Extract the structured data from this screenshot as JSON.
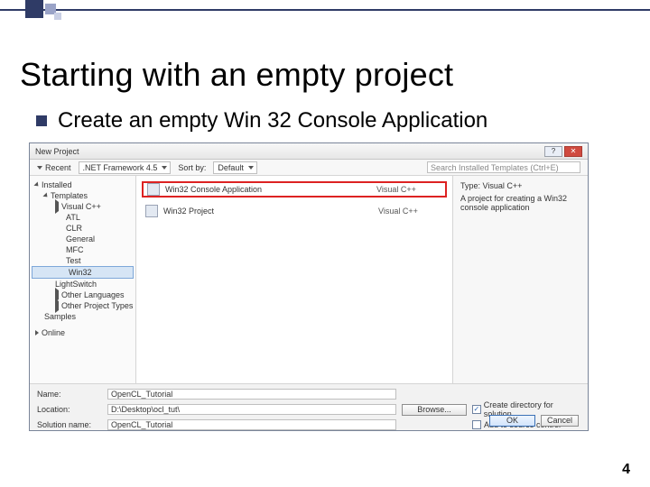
{
  "slide": {
    "title": "Starting with an empty project",
    "bullet": "Create an empty Win 32 Console Application",
    "page_number": "4"
  },
  "dialog": {
    "title": "New Project",
    "toolbar": {
      "recent_label": "Recent",
      "framework": ".NET Framework 4.5",
      "sortby_label": "Sort by:",
      "sortby_value": "Default",
      "search_placeholder": "Search Installed Templates (Ctrl+E)"
    },
    "tree": {
      "installed": "Installed",
      "templates": "Templates",
      "visual_cpp": "Visual C++",
      "items": [
        "ATL",
        "CLR",
        "General",
        "MFC",
        "Test",
        "Win32",
        "LightSwitch",
        "Other Languages",
        "Other Project Types",
        "Samples"
      ],
      "online": "Online"
    },
    "list": [
      {
        "name": "Win32 Console Application",
        "lang": "Visual C++"
      },
      {
        "name": "Win32 Project",
        "lang": "Visual C++"
      }
    ],
    "desc": {
      "type_line": "Type: Visual C++",
      "text": "A project for creating a Win32 console application"
    },
    "form": {
      "name_label": "Name:",
      "name_value": "OpenCL_Tutorial",
      "location_label": "Location:",
      "location_value": "D:\\Desktop\\ocl_tut\\",
      "browse": "Browse...",
      "solution_label": "Solution name:",
      "solution_value": "OpenCL_Tutorial",
      "chk_create_dir": "Create directory for solution",
      "chk_source_ctrl": "Add to source control",
      "ok": "OK",
      "cancel": "Cancel"
    }
  }
}
